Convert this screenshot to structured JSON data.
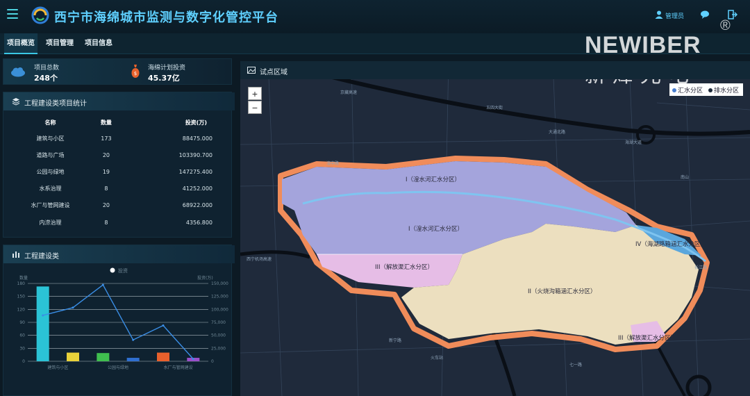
{
  "header": {
    "title": "西宁市海绵城市监测与数字化管控平台",
    "user_label": "管理员"
  },
  "watermark": {
    "brand_en": "NEWIBER",
    "registered": "®",
    "brand_cn": "新烽光电"
  },
  "tabs": [
    {
      "label": "项目概览",
      "active": true
    },
    {
      "label": "项目管理",
      "active": false
    },
    {
      "label": "项目信息",
      "active": false
    }
  ],
  "kpis": [
    {
      "label": "项目总数",
      "value": "248个",
      "icon": "cloud-icon"
    },
    {
      "label": "海绵计划投资",
      "value": "45.37亿",
      "icon": "money-bag-icon"
    }
  ],
  "stats_section": {
    "title": "工程建设类项目统计",
    "columns": [
      "名称",
      "数量",
      "投资(万)"
    ],
    "rows": [
      [
        "建筑与小区",
        "173",
        "88475.000"
      ],
      [
        "道路与广场",
        "20",
        "103390.700"
      ],
      [
        "公园与绿地",
        "19",
        "147275.400"
      ],
      [
        "水系治理",
        "8",
        "41252.000"
      ],
      [
        "水厂与管网建设",
        "20",
        "68922.000"
      ],
      [
        "内涝治理",
        "8",
        "4356.800"
      ]
    ]
  },
  "chart_section": {
    "title": "工程建设类",
    "legend_label": "投资"
  },
  "chart_data": {
    "type": "bar",
    "categories": [
      "建筑与小区",
      "道路与广场",
      "公园与绿地",
      "水系治理",
      "水厂与管网建设",
      "内涝治理"
    ],
    "category_labels_shown": [
      "建筑与小区",
      "公园与绿地",
      "水厂与管网建设"
    ],
    "series": [
      {
        "name": "数量",
        "type": "bar",
        "axis": "left",
        "values": [
          173,
          20,
          19,
          8,
          20,
          8
        ],
        "colors": [
          "#2bc3d6",
          "#e8d23a",
          "#3fbf4f",
          "#2f6fd0",
          "#e8602c",
          "#9b4fc9"
        ]
      },
      {
        "name": "投资",
        "type": "line",
        "axis": "right",
        "values": [
          88475.0,
          103390.7,
          147275.4,
          41252.0,
          68922.0,
          4356.8
        ],
        "color": "#3a8ee6"
      }
    ],
    "left_axis": {
      "label": "数量",
      "ticks": [
        "0",
        "30",
        "60",
        "90",
        "120",
        "150",
        "180"
      ],
      "ylim": [
        0,
        180
      ]
    },
    "right_axis": {
      "label": "投资(万)",
      "ticks": [
        "0",
        "25,000",
        "50,000",
        "75,000",
        "100,000",
        "125,000",
        "150,000"
      ],
      "ylim": [
        0,
        150000
      ]
    },
    "grid": true,
    "legend_position": "top-center"
  },
  "map": {
    "title": "试点区域",
    "zoom_in": "+",
    "zoom_out": "−",
    "legend": [
      {
        "label": "汇水分区",
        "color": "#4a7fd0"
      },
      {
        "label": "排水分区",
        "color": "#1e2a3a"
      }
    ],
    "zones": [
      {
        "label": "I（湟水河汇水分区）",
        "color": "#a4a4dc"
      },
      {
        "label": "I（湟水河汇水分区）",
        "color": "#a4a4dc"
      },
      {
        "label": "III（解放渠汇水分区）",
        "color": "#e6bde6"
      },
      {
        "label": "II（火烧沟箱涵汇水分区）",
        "color": "#ecdfbf"
      },
      {
        "label": "IV（海湖路箱涵汇水分区）",
        "color": "#5aa6dc"
      },
      {
        "label": "III（解放渠汇水分区）",
        "color": "#e6bde6"
      }
    ],
    "boundary_color": "#f08c5a",
    "river_color": "#7fc4f0",
    "streets": [
      "京藏高速",
      "大通北路",
      "西宁机场高速",
      "新宁路",
      "火车站",
      "七一路",
      "南山",
      "湟中路",
      "长江路",
      "五四大街",
      "海湖大道"
    ]
  }
}
